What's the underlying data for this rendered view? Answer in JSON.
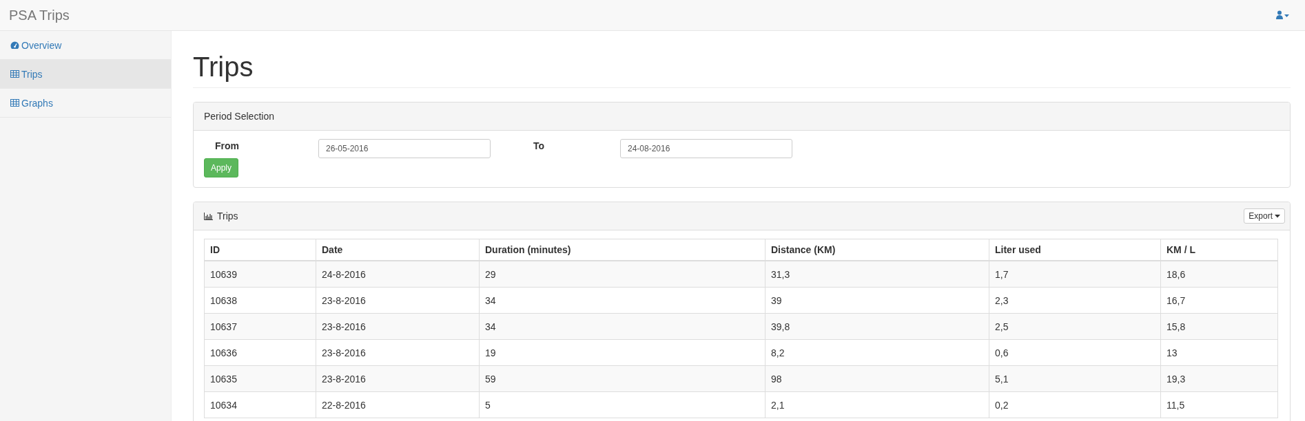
{
  "navbar": {
    "brand": "PSA Trips"
  },
  "sidebar": {
    "items": [
      {
        "label": "Overview",
        "kind": "dashboard",
        "selected": false
      },
      {
        "label": "Trips",
        "kind": "table",
        "selected": true
      },
      {
        "label": "Graphs",
        "kind": "table",
        "selected": false
      }
    ]
  },
  "page": {
    "title": "Trips"
  },
  "period_panel": {
    "title": "Period Selection",
    "from_label": "From",
    "from_value": "26-05-2016",
    "to_label": "To",
    "to_value": "24-08-2016",
    "apply_button": "Apply"
  },
  "trips_panel": {
    "title": "Trips",
    "export_button": "Export",
    "table": {
      "columns": [
        "ID",
        "Date",
        "Duration (minutes)",
        "Distance (KM)",
        "Liter used",
        "KM / L"
      ],
      "rows": [
        [
          "10639",
          "24-8-2016",
          "29",
          "31,3",
          "1,7",
          "18,6"
        ],
        [
          "10638",
          "23-8-2016",
          "34",
          "39",
          "2,3",
          "16,7"
        ],
        [
          "10637",
          "23-8-2016",
          "34",
          "39,8",
          "2,5",
          "15,8"
        ],
        [
          "10636",
          "23-8-2016",
          "19",
          "8,2",
          "0,6",
          "13"
        ],
        [
          "10635",
          "23-8-2016",
          "59",
          "98",
          "5,1",
          "19,3"
        ],
        [
          "10634",
          "22-8-2016",
          "5",
          "2,1",
          "0,2",
          "11,5"
        ]
      ]
    }
  }
}
